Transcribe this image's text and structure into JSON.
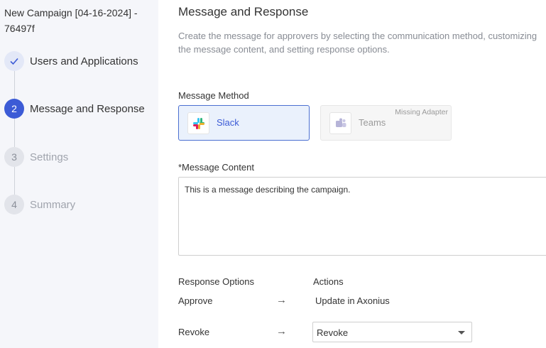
{
  "campaign": {
    "title": "New Campaign [04-16-2024] - 76497f"
  },
  "steps": [
    {
      "number": "1",
      "label": "Users and Applications",
      "state": "completed",
      "icon": "check-icon"
    },
    {
      "number": "2",
      "label": "Message and Response",
      "state": "active"
    },
    {
      "number": "3",
      "label": "Settings",
      "state": "pending"
    },
    {
      "number": "4",
      "label": "Summary",
      "state": "pending"
    }
  ],
  "main": {
    "title": "Message and Response",
    "description": "Create the message for approvers by selecting the communication method, customizing the message content, and setting response options."
  },
  "message_method": {
    "label": "Message Method",
    "options": [
      {
        "name": "Slack",
        "icon": "slack-icon",
        "selected": true
      },
      {
        "name": "Teams",
        "icon": "teams-icon",
        "selected": false,
        "badge": "Missing Adapter"
      }
    ]
  },
  "message_content": {
    "label": "*Message Content",
    "value": "This is a message describing the campaign."
  },
  "responses": {
    "options_header": "Response Options",
    "actions_header": "Actions",
    "rows": [
      {
        "option": "Approve",
        "action": "Update in Axonius"
      },
      {
        "option": "Revoke",
        "action": "Revoke"
      }
    ]
  },
  "colors": {
    "accent": "#3c5bd6",
    "sidebar_bg": "#f5f6fa",
    "selected_bg": "#eaf1fc"
  }
}
